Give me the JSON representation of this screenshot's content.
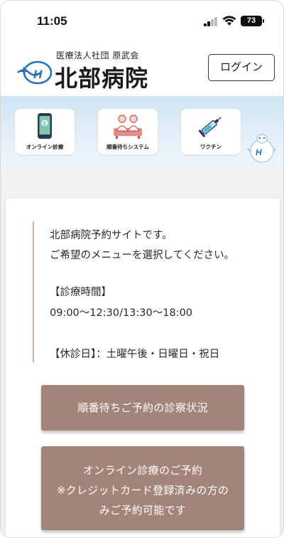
{
  "status_bar": {
    "time": "11:05",
    "battery": "73"
  },
  "header": {
    "org_name": "医療法人社団 原武会",
    "hospital_name": "北部病院",
    "login_label": "ログイン"
  },
  "menu": {
    "items": [
      {
        "label": "オンライン診療",
        "icon": "smartphone-icon"
      },
      {
        "label": "順番待ちシステム",
        "icon": "waiting-people-icon"
      },
      {
        "label": "ワクチン",
        "icon": "syringe-icon"
      }
    ]
  },
  "info": {
    "intro_line1": "北部病院予約サイトです。",
    "intro_line2": "ご希望のメニューを選択してください。",
    "hours_heading": "【診療時間】",
    "hours_value": "09:00〜12:30/13:30〜18:00",
    "closed_days": "【休診日】：土曜午後・日曜日・祝日"
  },
  "buttons": {
    "queue_status": "順番待ちご予約の診察状況",
    "online_line1": "オンライン診療のご予約",
    "online_line2": "※クレジットカード登録済みの方の",
    "online_line3": "みご予約可能です"
  },
  "colors": {
    "button_bg": "#a28479",
    "accent_border": "#c9b49a",
    "banner_bg": "#cfe4f3",
    "logo_blue": "#1f6fc2"
  }
}
